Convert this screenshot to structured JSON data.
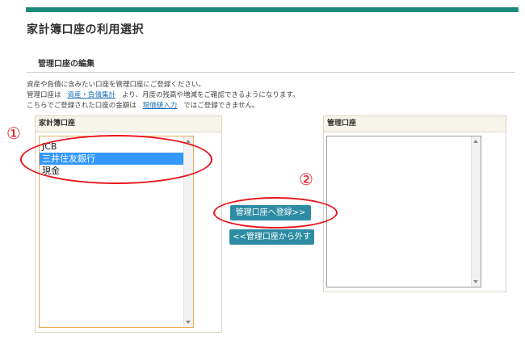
{
  "page": {
    "title": "家計簿口座の利用選択",
    "section_title": "管理口座の編集",
    "desc_line1": "資産や負債に含みたい口座を管理口座にご登録ください。",
    "desc_line2_pre": "管理口座は",
    "desc_line2_link": "資産・負債集計",
    "desc_line2_post": "より、月度の残高や増減をご確認できるようになります。",
    "desc_line3_pre": "こちらでご登録された口座の金額は",
    "desc_line3_link": "現価値入力",
    "desc_line3_post": "ではご登録できません。"
  },
  "left_panel": {
    "header": "家計簿口座",
    "options": [
      "JCB",
      "三井住友銀行",
      "現金"
    ],
    "selected": "三井住友銀行"
  },
  "right_panel": {
    "header": "管理口座",
    "options": []
  },
  "buttons": {
    "register": "管理口座へ登録>>",
    "remove": "<<管理口座から外す"
  },
  "annotations": {
    "marker1": "①",
    "marker2": "②",
    "color": "#e8141c"
  },
  "colors": {
    "accent_bar": "#1e8a7e",
    "button": "#2d8ca3",
    "link": "#1a6fb5",
    "selection": "#3399ff"
  }
}
